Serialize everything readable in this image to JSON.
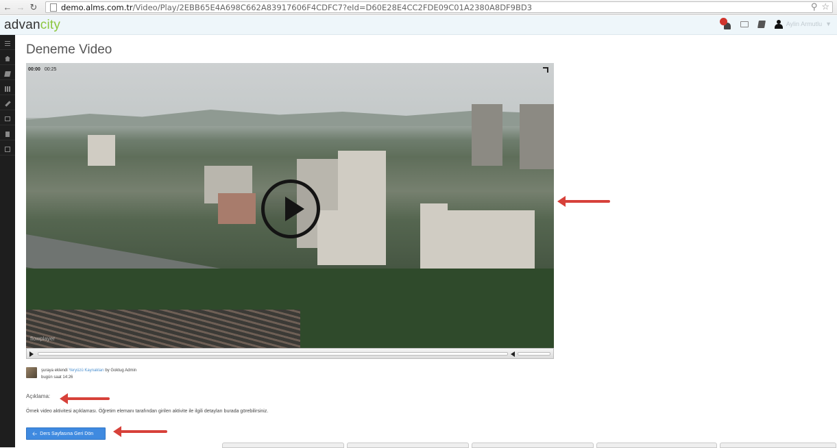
{
  "browser": {
    "url_host": "demo.alms.com.tr",
    "url_path": "/Video/Play/2EBB65E4A698C662A83917606F4CDFC7?eId=D60E28E4CC2FDE09C01A2380A8DF9BD3"
  },
  "app": {
    "logo_main": "advan",
    "logo_accent": "city",
    "user_name": "Aylin Armutlu"
  },
  "page": {
    "title": "Deneme Video"
  },
  "video": {
    "current_time": "00:00",
    "duration": "00:25",
    "watermark": "flowplayer"
  },
  "activity": {
    "prefix": "şuraya eklendi",
    "link": "Yeryüzü Kaynakları",
    "by": "by Goktug Admin",
    "time": "bugün saat 14:26"
  },
  "description": {
    "label": "Açıklama:",
    "text": "Örnek video aktivitesi açıklaması. Öğretim elemanı tarafından girilen aktivite ile ilgili detayları burada görebilirsiniz."
  },
  "actions": {
    "back_label": "Ders Sayfasına Geri Dön"
  },
  "colors": {
    "accent": "#8cc63e",
    "primary_button": "#3f8ae0",
    "annotation": "#d7413a",
    "sidebar": "#1e1e1e"
  }
}
